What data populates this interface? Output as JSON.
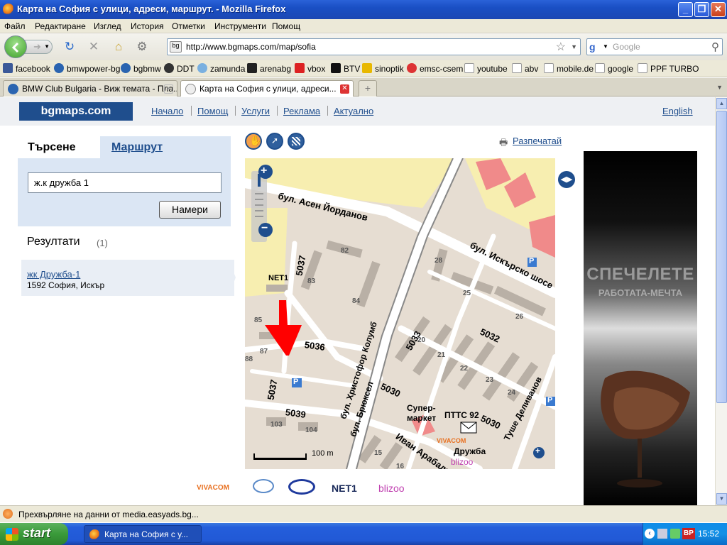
{
  "window": {
    "title": "Карта на София с улици, адреси, маршрут. - Mozilla Firefox",
    "minimize": "_",
    "maximize": "❐",
    "close": "✕"
  },
  "menu": [
    "Файл",
    "Редактиране",
    "Изглед",
    "История",
    "Отметки",
    "Инструменти",
    "Помощ"
  ],
  "nav": {
    "url": "http://www.bgmaps.com/map/sofia",
    "search_placeholder": "Google"
  },
  "bookmarks": [
    "facebook",
    "bmwpower-bg",
    "bgbmw",
    "DDT",
    "zamunda",
    "arenabg",
    "vbox",
    "BTV",
    "sinoptik",
    "emsc-csem",
    "youtube",
    "abv",
    "mobile.de",
    "google",
    "PPF TURBO"
  ],
  "tabs": [
    {
      "label": "BMW Club Bulgaria - Виж темата - Пла...",
      "active": false
    },
    {
      "label": "Карта на София с улици, адреси...",
      "active": true
    }
  ],
  "site": {
    "logo": "bgmaps.com",
    "links": [
      "Начало",
      "Помощ",
      "Услуги",
      "Реклама",
      "Актуално"
    ],
    "language": "English"
  },
  "search": {
    "tab_search": "Търсене",
    "tab_route": "Маршрут",
    "query": "ж.к дружба 1",
    "button": "Намери",
    "results_title": "Резултати",
    "results_count": "(1)",
    "result_name": "жк Дружба-1",
    "result_address": "1592 София, Искър"
  },
  "map": {
    "print": "Разпечатай",
    "scale": "100 m",
    "zoom_in": "+",
    "zoom_out": "−",
    "expand": "◀▶",
    "labels": {
      "asen": "бул. Асен Йорданов",
      "iskarsko": "бул. Искърско шосе",
      "kolumb": "бул. Христофор Колумб",
      "bruksel": "бул. Брюксел",
      "arabadzhiev": "Иван Арабаджиев",
      "delivanov": "Туше Деливанов",
      "supermarket": "Супер-\nмаркет",
      "ptts": "ПТТС 92",
      "druzhba": "Дружба",
      "s5037a": "5037",
      "s5037b": "5037",
      "s5036": "5036",
      "s5039": "5039",
      "s5030a": "5030",
      "s5030b": "5030",
      "s5032": "5032",
      "s5033": "5033",
      "b82": "82",
      "b83": "83",
      "b84": "84",
      "b85": "85",
      "b87": "87",
      "b88": "88",
      "b28": "28",
      "b25": "25",
      "b26": "26",
      "b20": "20",
      "b21": "21",
      "b22": "22",
      "b23": "23",
      "b24": "24",
      "b103": "103",
      "b104": "104",
      "b15": "15",
      "b16": "16",
      "net1": "NET1",
      "vivacom": "VIVACOM",
      "blizoo": "blizoo",
      "parking": "P"
    }
  },
  "ad": {
    "headline": "СПЕЧЕЛЕТЕ",
    "subline": "РАБОТАТА-МЕЧТА"
  },
  "partners": [
    "VIVACOM",
    "NET1",
    "blizoo"
  ],
  "status": "Прехвърляне на данни от media.easyads.bg...",
  "taskbar": {
    "start": "start",
    "item": "Карта на София с у...",
    "tray_lang": "BP",
    "clock": "15:52"
  },
  "colors": {
    "brand": "#1f4e8d",
    "marker": "#ff0000",
    "map_bg": "#e6ddd2",
    "map_road": "#ffffff",
    "map_block": "#f7eeb0"
  }
}
